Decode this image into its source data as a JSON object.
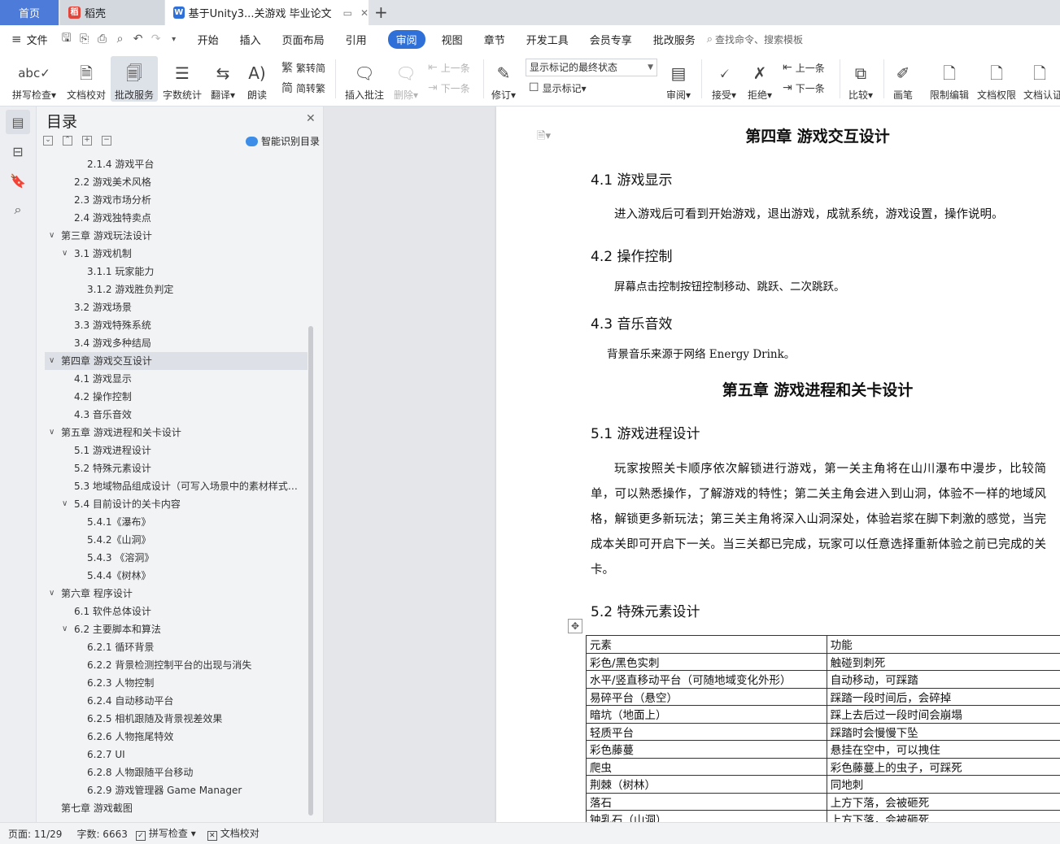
{
  "tabs": {
    "home": "首页",
    "docer": "稻壳",
    "doc": "基于Unity3...关游戏 毕业论文",
    "add": "+"
  },
  "menu": {
    "file": "文件",
    "items": [
      "开始",
      "插入",
      "页面布局",
      "引用",
      "审阅",
      "视图",
      "章节",
      "开发工具",
      "会员专享",
      "批改服务"
    ],
    "active": "审阅",
    "search_placeholder": "查找命令、搜索模板"
  },
  "ribbon": {
    "spellcheck": "拼写检查",
    "doc_check": "文档校对",
    "revise_service": "批改服务",
    "word_count": "字数统计",
    "translate": "翻译",
    "read_aloud": "朗读",
    "trad_to_simp": "繁转简",
    "simp_to_trad": "简转繁",
    "insert_comment": "插入批注",
    "delete": "删除",
    "prev": "上一条",
    "next": "下一条",
    "revise": "修订",
    "markup_state": "显示标记的最终状态",
    "show_markup": "显示标记",
    "review": "审阅",
    "accept": "接受",
    "reject": "拒绝",
    "prev2": "上一条",
    "next2": "下一条",
    "compare": "比较",
    "pen": "画笔",
    "restrict_edit": "限制编辑",
    "doc_permission": "文档权限",
    "doc_certify": "文档认证"
  },
  "toc": {
    "title": "目录",
    "smart": "智能识别目录",
    "items": [
      {
        "label": "2.1.4 游戏平台",
        "level": 3,
        "chev": ""
      },
      {
        "label": "2.2 游戏美术风格",
        "level": 2,
        "chev": ""
      },
      {
        "label": "2.3 游戏市场分析",
        "level": 2,
        "chev": ""
      },
      {
        "label": "2.4 游戏独特卖点",
        "level": 2,
        "chev": ""
      },
      {
        "label": "第三章  游戏玩法设计",
        "level": 1,
        "chev": "v"
      },
      {
        "label": "3.1 游戏机制",
        "level": 2,
        "chev": "v"
      },
      {
        "label": "3.1.1 玩家能力",
        "level": 3,
        "chev": ""
      },
      {
        "label": "3.1.2 游戏胜负判定",
        "level": 3,
        "chev": ""
      },
      {
        "label": "3.2 游戏场景",
        "level": 2,
        "chev": ""
      },
      {
        "label": "3.3 游戏特殊系统",
        "level": 2,
        "chev": ""
      },
      {
        "label": "3.4 游戏多种结局",
        "level": 2,
        "chev": ""
      },
      {
        "label": "第四章  游戏交互设计",
        "level": 1,
        "chev": "v",
        "selected": true
      },
      {
        "label": "4.1 游戏显示",
        "level": 2,
        "chev": ""
      },
      {
        "label": "4.2 操作控制",
        "level": 2,
        "chev": ""
      },
      {
        "label": "4.3 音乐音效",
        "level": 2,
        "chev": ""
      },
      {
        "label": "第五章  游戏进程和关卡设计",
        "level": 1,
        "chev": "v"
      },
      {
        "label": "5.1 游戏进程设计",
        "level": 2,
        "chev": ""
      },
      {
        "label": "5.2  特殊元素设计",
        "level": 2,
        "chev": ""
      },
      {
        "label": "5.3 地域物品组成设计（可写入场景中的素材样式…",
        "level": 2,
        "chev": ""
      },
      {
        "label": "5.4 目前设计的关卡内容",
        "level": 2,
        "chev": "v"
      },
      {
        "label": "5.4.1《瀑布》",
        "level": 3,
        "chev": ""
      },
      {
        "label": "5.4.2《山洞》",
        "level": 3,
        "chev": ""
      },
      {
        "label": "5.4.3  《溶洞》",
        "level": 3,
        "chev": ""
      },
      {
        "label": "5.4.4《树林》",
        "level": 3,
        "chev": ""
      },
      {
        "label": "第六章  程序设计",
        "level": 1,
        "chev": "v"
      },
      {
        "label": "6.1 软件总体设计",
        "level": 2,
        "chev": ""
      },
      {
        "label": "6.2 主要脚本和算法",
        "level": 2,
        "chev": "v"
      },
      {
        "label": "6.2.1 循环背景",
        "level": 3,
        "chev": ""
      },
      {
        "label": "6.2.2 背景检测控制平台的出现与消失",
        "level": 3,
        "chev": ""
      },
      {
        "label": "6.2.3 人物控制",
        "level": 3,
        "chev": ""
      },
      {
        "label": "6.2.4 自动移动平台",
        "level": 3,
        "chev": ""
      },
      {
        "label": "6.2.5 相机跟随及背景视差效果",
        "level": 3,
        "chev": ""
      },
      {
        "label": "6.2.6 人物拖尾特效",
        "level": 3,
        "chev": ""
      },
      {
        "label": "6.2.7 UI",
        "level": 3,
        "chev": ""
      },
      {
        "label": "6.2.8  人物跟随平台移动",
        "level": 3,
        "chev": ""
      },
      {
        "label": "6.2.9  游戏管理器 Game Manager",
        "level": 3,
        "chev": ""
      },
      {
        "label": "第七章  游戏截图",
        "level": 1,
        "chev": ""
      }
    ]
  },
  "document": {
    "ch4_title": "第四章  游戏交互设计",
    "s41": "4.1 游戏显示",
    "p41": "进入游戏后可看到开始游戏，退出游戏，成就系统，游戏设置，操作说明。",
    "s42": "4.2 操作控制",
    "p42": "屏幕点击控制按钮控制移动、跳跃、二次跳跃。",
    "s43": "4.3 音乐音效",
    "p43": "背景音乐来源于网络 Energy Drink。",
    "ch5_title": "第五章  游戏进程和关卡设计",
    "s51": "5.1 游戏进程设计",
    "p51": "玩家按照关卡顺序依次解锁进行游戏，第一关主角将在山川瀑布中漫步，比较简单，可以熟悉操作，了解游戏的特性；第二关主角会进入到山洞，体验不一样的地域风格，解锁更多新玩法；第三关主角将深入山洞深处，体验岩浆在脚下刺激的感觉，当完成本关即可开启下一关。当三关都已完成，玩家可以任意选择重新体验之前已完成的关卡。",
    "s52": "5.2  特殊元素设计",
    "table_header": [
      "元素",
      "功能"
    ],
    "table_rows": [
      [
        "彩色/黑色实刺",
        "触碰到刺死"
      ],
      [
        "水平/竖直移动平台（可随地域变化外形）",
        "自动移动，可踩踏"
      ],
      [
        "易碎平台（悬空）",
        "踩踏一段时间后，会碎掉"
      ],
      [
        "暗坑（地面上）",
        "踩上去后过一段时间会崩塌"
      ],
      [
        "轻质平台",
        "踩踏时会慢慢下坠"
      ],
      [
        "彩色藤蔓",
        "悬挂在空中，可以拽住"
      ],
      [
        "爬虫",
        "彩色藤蔓上的虫子，可踩死"
      ],
      [
        "荆棘（树林）",
        "同地刺"
      ],
      [
        "落石",
        "上方下落，会被砸死"
      ],
      [
        "钟乳石（山洞）",
        "上方下落，会被砸死"
      ]
    ]
  },
  "status": {
    "page": "页面: 11/29",
    "words": "字数: 6663",
    "spell": "拼写检查",
    "doc_check": "文档校对"
  }
}
